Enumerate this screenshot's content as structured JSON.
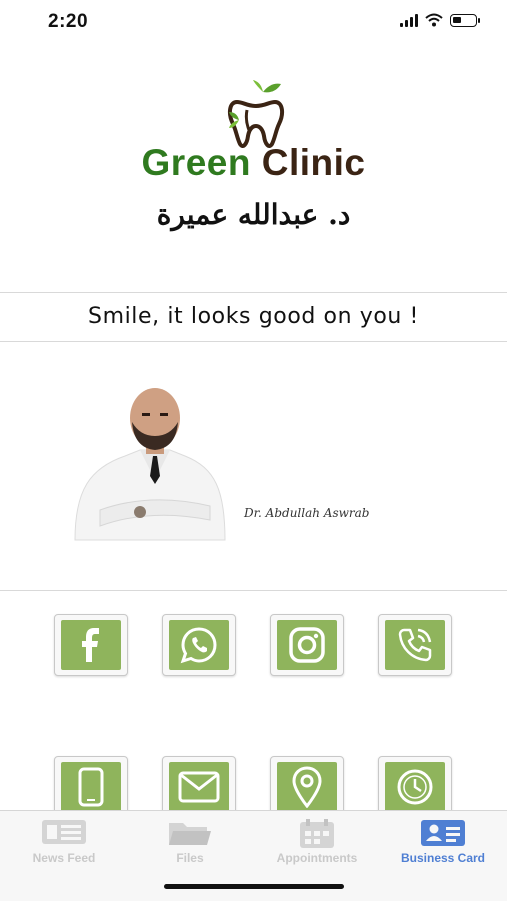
{
  "status_bar": {
    "time": "2:20"
  },
  "header": {
    "clinic_name_part1": "Green",
    "clinic_name_part2": "Clinic",
    "arabic_name": "د. عبدالله عميرة"
  },
  "slogan": "Smile, it looks good on you !",
  "signature": "Dr. Abdullah Aswrab",
  "contact_buttons": [
    {
      "name": "facebook-button",
      "icon": "facebook-icon"
    },
    {
      "name": "whatsapp-button",
      "icon": "whatsapp-icon"
    },
    {
      "name": "instagram-button",
      "icon": "instagram-icon"
    },
    {
      "name": "phone-button",
      "icon": "phone-icon"
    },
    {
      "name": "mobile-button",
      "icon": "mobile-icon"
    },
    {
      "name": "email-button",
      "icon": "mail-icon"
    },
    {
      "name": "location-button",
      "icon": "location-pin-icon"
    },
    {
      "name": "hours-button",
      "icon": "clock-icon"
    }
  ],
  "colors": {
    "accent_green": "#8fb45c",
    "active_tab": "#4f7fd3",
    "inactive_tab": "#c9c9c9"
  },
  "tabs": [
    {
      "label": "News Feed",
      "icon": "newspaper-icon",
      "active": false
    },
    {
      "label": "Files",
      "icon": "folder-icon",
      "active": false
    },
    {
      "label": "Appointments",
      "icon": "calendar-icon",
      "active": false
    },
    {
      "label": "Business Card",
      "icon": "contact-card-icon",
      "active": true
    }
  ]
}
